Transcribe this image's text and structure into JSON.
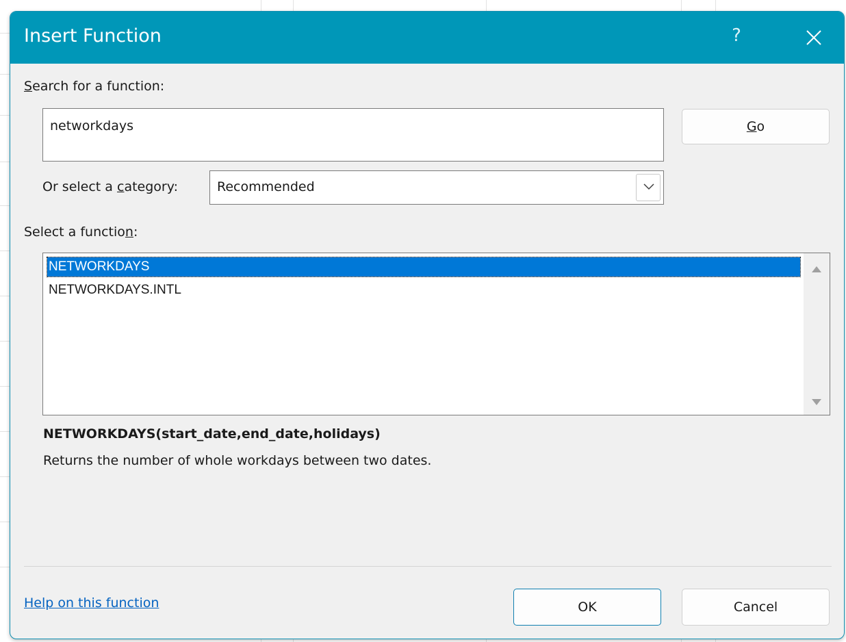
{
  "dialog": {
    "title": "Insert Function",
    "help_glyph": "?",
    "colors": {
      "titlebar": "#0097b8",
      "accent": "#0078d7",
      "link": "#0563c1"
    }
  },
  "search": {
    "label_accel": "S",
    "label_rest": "earch for a function:",
    "value": "networkdays",
    "go_accel": "G",
    "go_rest": "o"
  },
  "category": {
    "label_pre": "Or select a ",
    "label_accel": "c",
    "label_post": "ategory:",
    "selected": "Recommended"
  },
  "functions": {
    "label_pre": "Select a functio",
    "label_accel": "n",
    "label_post": ":",
    "items": [
      "NETWORKDAYS",
      "NETWORKDAYS.INTL"
    ],
    "selected_index": 0
  },
  "details": {
    "signature": "NETWORKDAYS(start_date,end_date,holidays)",
    "description": "Returns the number of whole workdays between two dates."
  },
  "footer": {
    "help_link": "Help on this function",
    "ok_label": "OK",
    "cancel_label": "Cancel"
  },
  "icons": [
    "help-icon",
    "close-icon",
    "chevron-down-icon",
    "scroll-up-arrow-icon",
    "scroll-down-arrow-icon"
  ]
}
